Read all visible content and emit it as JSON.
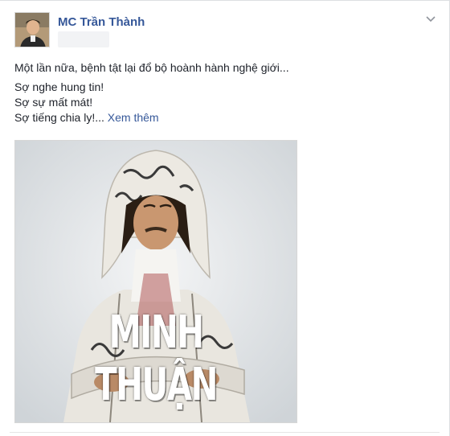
{
  "post": {
    "author": "MC Trần Thành",
    "lines": [
      "Một lần nữa, bệnh tật lại đổ bộ hoành hành nghệ giới...",
      "Sợ nghe hung tin!",
      "Sợ sự mất mát!",
      "Sợ tiếng chia ly!..."
    ],
    "see_more": "Xem thêm",
    "photo_caption": "MINH THUẬN"
  },
  "icons": {
    "menu": "chevron-down-icon"
  },
  "colors": {
    "link": "#365899",
    "text": "#1d2129",
    "caption": "#ffffff"
  }
}
